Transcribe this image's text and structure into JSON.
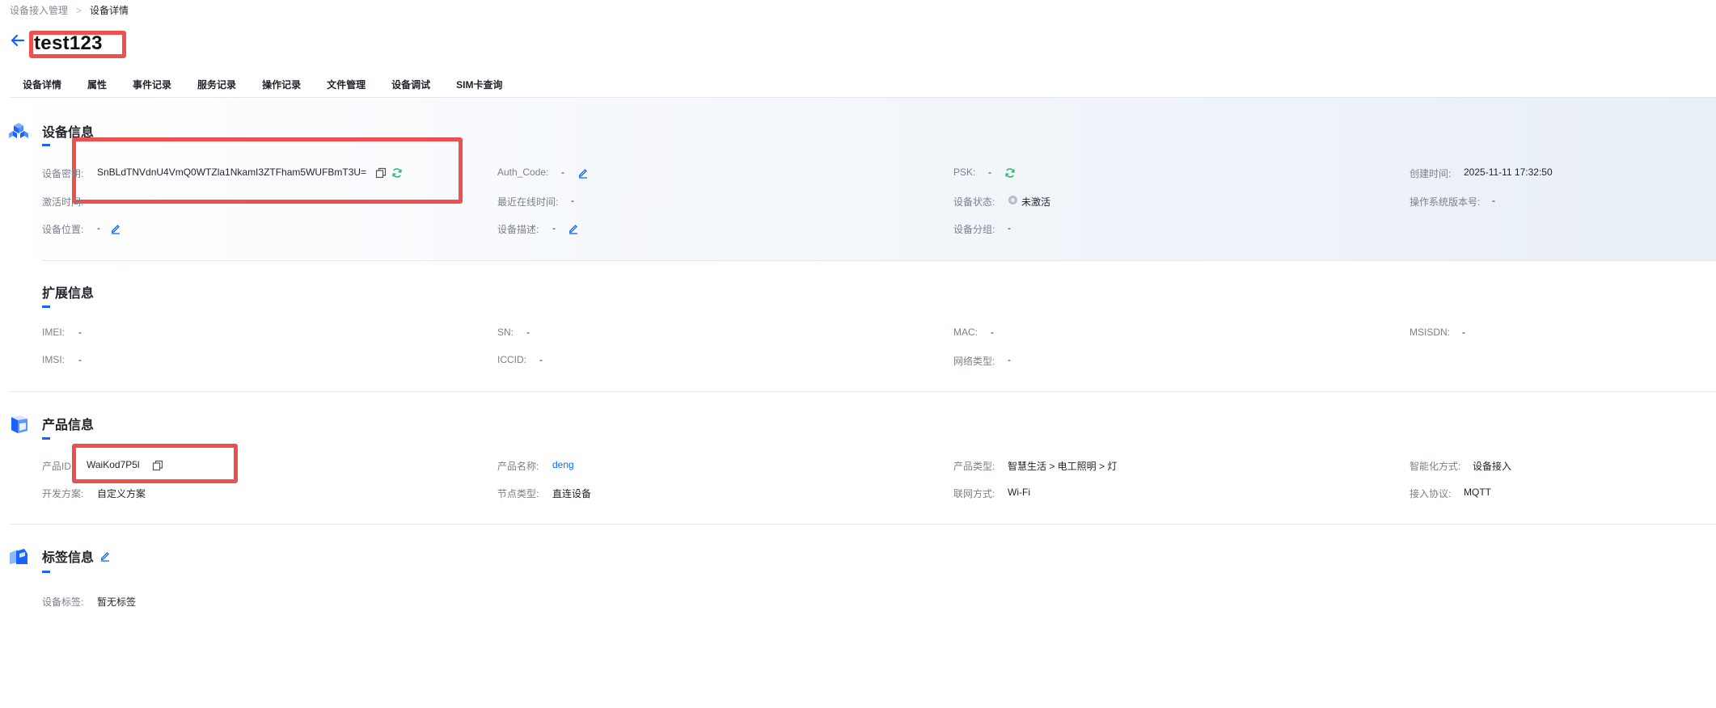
{
  "breadcrumb": {
    "parent": "设备接入管理",
    "separator": ">",
    "current": "设备详情"
  },
  "device_name": "test123",
  "tabs": [
    "设备详情",
    "属性",
    "事件记录",
    "服务记录",
    "操作记录",
    "文件管理",
    "设备调试",
    "SIM卡查询"
  ],
  "active_tab": "设备详情",
  "device_info": {
    "title": "设备信息",
    "secret_label": "设备密钥:",
    "secret_value": "SnBLdTNVdnU4VmQ0WTZla1NkamI3ZTFham5WUFBmT3U=",
    "auth_code_label": "Auth_Code:",
    "auth_code_value": "-",
    "psk_label": "PSK:",
    "psk_value": "-",
    "created_label": "创建时间:",
    "created_value": "2025-11-11 17:32:50",
    "activated_label": "激活时间:",
    "last_online_label": "最近在线时间:",
    "last_online_value": "-",
    "status_label": "设备状态:",
    "status_value": "未激活",
    "os_version_label": "操作系统版本号:",
    "os_version_value": "-",
    "location_label": "设备位置:",
    "location_value": "-",
    "desc_label": "设备描述:",
    "desc_value": "-",
    "group_label": "设备分组:",
    "group_value": "-"
  },
  "ext_info": {
    "title": "扩展信息",
    "imei_label": "IMEI:",
    "imei_value": "-",
    "sn_label": "SN:",
    "sn_value": "-",
    "mac_label": "MAC:",
    "mac_value": "-",
    "msisdn_label": "MSISDN:",
    "msisdn_value": "-",
    "imsi_label": "IMSI:",
    "imsi_value": "-",
    "iccid_label": "ICCID:",
    "iccid_value": "-",
    "network_type_label": "网络类型:",
    "network_type_value": "-"
  },
  "product_info": {
    "title": "产品信息",
    "id_label": "产品ID:",
    "id_value": "WaiKod7P5l",
    "name_label": "产品名称:",
    "name_value": "deng",
    "type_label": "产品类型:",
    "type_value": "智慧生活 > 电工照明 > 灯",
    "smart_label": "智能化方式:",
    "smart_value": "设备接入",
    "dev_plan_label": "开发方案:",
    "dev_plan_value": "自定义方案",
    "node_type_label": "节点类型:",
    "node_type_value": "直连设备",
    "network_label": "联网方式:",
    "network_value": "Wi-Fi",
    "protocol_label": "接入协议:",
    "protocol_value": "MQTT"
  },
  "tag_info": {
    "title": "标签信息",
    "tags_label": "设备标签:",
    "tags_value": "暂无标签"
  },
  "icons": {
    "back": "arrow-left-icon",
    "copy": "copy-icon",
    "refresh": "refresh-icon",
    "edit": "edit-pencil-icon",
    "device_section": "cubes-icon",
    "product_section": "box-icon",
    "tag_section": "tag-icon"
  },
  "colors": {
    "accent": "#1664ff",
    "highlight": "#ee5051",
    "refresh": "#2db56e"
  }
}
